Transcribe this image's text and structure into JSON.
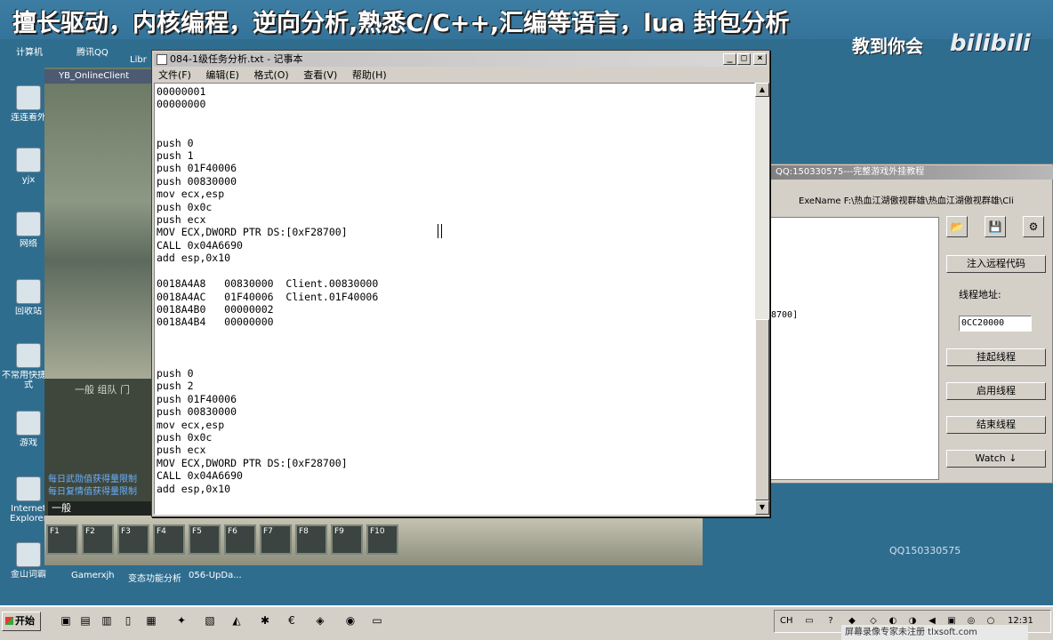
{
  "banner": {
    "headline": "擅长驱动，内核编程，逆向分析,熟悉C/C++,汇编等语言，lua 封包分析",
    "subline": "教到你会",
    "logo": "bilibili"
  },
  "desktop": {
    "top_icons": [
      "计算机",
      "腾讯QQ",
      "Libr"
    ],
    "left_icons": [
      "连连着外",
      "yjx",
      "网络",
      "回收站",
      "不常用快捷方式",
      "游戏",
      "Internet Explorer",
      "金山词霸"
    ],
    "bottom_icons": [
      "Gamerxjh",
      "变态功能分析",
      "056-UpDa..."
    ]
  },
  "game": {
    "title": "YB_OnlineClient",
    "tabs": "一般  组队  门",
    "messages": [
      "每日武勋值获得量限制",
      "每日复情值获得量限制"
    ],
    "channel": "一般",
    "skill_slots": [
      "F1",
      "F2",
      "F3",
      "F4",
      "F5",
      "F6",
      "F7",
      "F8",
      "F9",
      "F10"
    ]
  },
  "notepad": {
    "title": "084-1级任务分析.txt - 记事本",
    "menu": [
      "文件(F)",
      "编辑(E)",
      "格式(O)",
      "查看(V)",
      "帮助(H)"
    ],
    "lines": [
      "00000001",
      "00000000",
      "",
      "",
      "push 0",
      "push 1",
      "push 01F40006",
      "push 00830000",
      "mov ecx,esp",
      "push 0x0c",
      "push ecx",
      "MOV ECX,DWORD PTR DS:[0xF28700]",
      "CALL 0x04A6690",
      "add esp,0x10",
      "",
      "0018A4A8   00830000  Client.00830000",
      "0018A4AC   01F40006  Client.01F40006",
      "0018A4B0   00000002",
      "0018A4B4   00000000",
      "",
      "",
      "",
      "push 0",
      "push 2",
      "push 01F40006",
      "push 00830000",
      "mov ecx,esp",
      "push 0x0c",
      "push ecx",
      "MOV ECX,DWORD PTR DS:[0xF28700]",
      "CALL 0x04A6690",
      "add esp,0x10"
    ]
  },
  "tool": {
    "title": "QQ:150330575---完整游戏外挂教程",
    "exe_label": "ExeName  F:\\热血江湖傲视群雄\\热血江湖傲视群雄\\Cli",
    "list_fragment": "8700]",
    "inject_label": "注入远程代码",
    "thread_addr_label": "线程地址:",
    "thread_addr_value": "0CC20000",
    "suspend_label": "挂起线程",
    "resume_label": "启用线程",
    "end_label": "结束线程",
    "watch_label": "Watch ↓",
    "qq_number": "QQ150330575"
  },
  "taskbar": {
    "start_label": "开始",
    "ime": "CH",
    "clock": "12:31",
    "watermark": "屏幕录像专家未注册  tlxsoft.com"
  }
}
